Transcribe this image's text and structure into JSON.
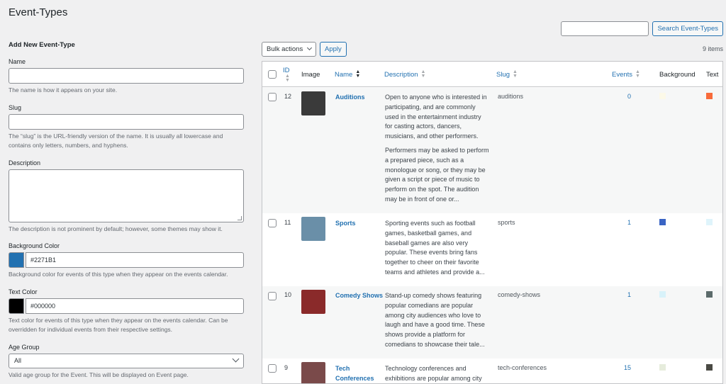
{
  "page_title": "Event-Types",
  "search": {
    "button": "Search Event-Types",
    "value": ""
  },
  "form": {
    "heading": "Add New Event-Type",
    "name_label": "Name",
    "name_help": "The name is how it appears on your site.",
    "slug_label": "Slug",
    "slug_help": "The “slug” is the URL-friendly version of the name. It is usually all lowercase and contains only letters, numbers, and hyphens.",
    "desc_label": "Description",
    "desc_help": "The description is not prominent by default; however, some themes may show it.",
    "bg_label": "Background Color",
    "bg_value": "#2271B1",
    "bg_color": "#2271b1",
    "bg_help": "Background color for events of this type when they appear on the events calendar.",
    "text_label": "Text Color",
    "text_value": "#000000",
    "text_color": "#000000",
    "text_help": "Text color for events of this type when they appear on the events calendar. Can be overridden for individual events from their respective settings.",
    "age_label": "Age Group",
    "age_value": "All",
    "age_help": "Valid age group for the Event. This will be displayed on Event page."
  },
  "tablenav": {
    "bulk": "Bulk actions",
    "apply": "Apply",
    "count": "9 items"
  },
  "columns": {
    "id": "ID",
    "image": "Image",
    "name": "Name",
    "description": "Description",
    "slug": "Slug",
    "events": "Events",
    "background": "Background",
    "text": "Text"
  },
  "rows": [
    {
      "id": "12",
      "name": "Auditions",
      "description": [
        "Open to anyone who is interested in participating, and are commonly used in the entertainment industry for casting actors, dancers, musicians, and other performers.",
        "Performers may be asked to perform a prepared piece, such as a monologue or song, or they may be given a script or piece of music to perform on the spot. The audition may be in front of one or..."
      ],
      "slug": "auditions",
      "events": "0",
      "bg": "#fcf9e8",
      "text": "#f86b3b",
      "thumb": "#3a3a3a"
    },
    {
      "id": "11",
      "name": "Sports",
      "description": [
        "Sporting events such as football games, basketball games, and baseball games are also very popular. These events bring fans together to cheer on their favorite teams and athletes and provide a..."
      ],
      "slug": "sports",
      "events": "1",
      "bg": "#3a64c4",
      "text": "#dff4fb",
      "thumb": "#6a8fa8"
    },
    {
      "id": "10",
      "name": "Comedy Shows",
      "description": [
        "Stand-up comedy shows featuring popular comedians are popular among city audiences who love to laugh and have a good time. These shows provide a platform for comedians to showcase their tale..."
      ],
      "slug": "comedy-shows",
      "events": "1",
      "bg": "#d8f2fa",
      "text": "#5c6b6b",
      "thumb": "#8a2a2a"
    },
    {
      "id": "9",
      "name": "Tech Conferences",
      "description": [
        "Technology conferences and exhibitions are popular among city"
      ],
      "slug": "tech-conferences",
      "events": "15",
      "bg": "#e6ecdc",
      "text": "#4a4a44",
      "thumb": "#7a4a4a"
    }
  ]
}
